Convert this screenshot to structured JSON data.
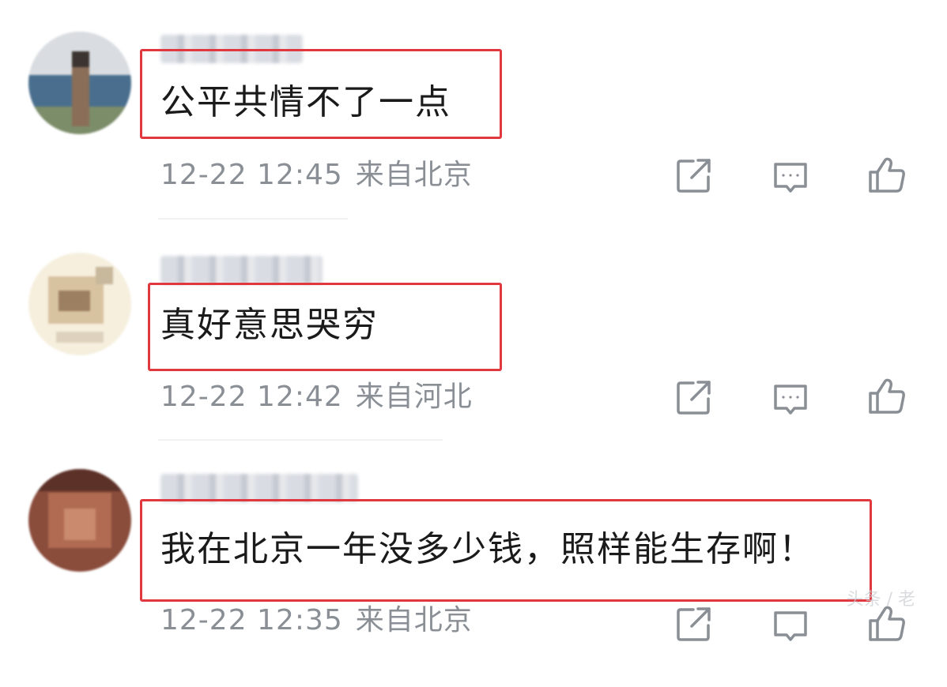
{
  "comments": [
    {
      "username": "",
      "text": "公平共情不了一点",
      "time": "12-22 12:45",
      "location": "来自北京",
      "avatar_colors": [
        "#4a6f8e",
        "#7c8d6a",
        "#b9a78a",
        "#3b3430",
        "#d8cfc0",
        "#6e8fa8"
      ]
    },
    {
      "username": "",
      "text": "真好意思哭穷",
      "time": "12-22 12:42",
      "location": "来自河北",
      "avatar_colors": [
        "#f4ecd8",
        "#c9a27a",
        "#e7d8bd",
        "#8e7760",
        "#f8f2e4",
        "#d6c2a0"
      ]
    },
    {
      "username": "",
      "text": "我在北京一年没多少钱，照样能生存啊！",
      "time": "12-22 12:35",
      "location": "来自北京",
      "avatar_colors": [
        "#7a4536",
        "#a25a43",
        "#5c3128",
        "#c07a5e",
        "#8d4e3c",
        "#b36a52"
      ]
    }
  ],
  "actions": {
    "share": "share-icon",
    "reply": "comment-icon",
    "like": "thumbs-up-icon"
  },
  "colors": {
    "highlight_border": "#e0383e",
    "meta_text": "#8a8f96",
    "icon": "#8a8f96"
  },
  "watermark": "头条 / 老"
}
